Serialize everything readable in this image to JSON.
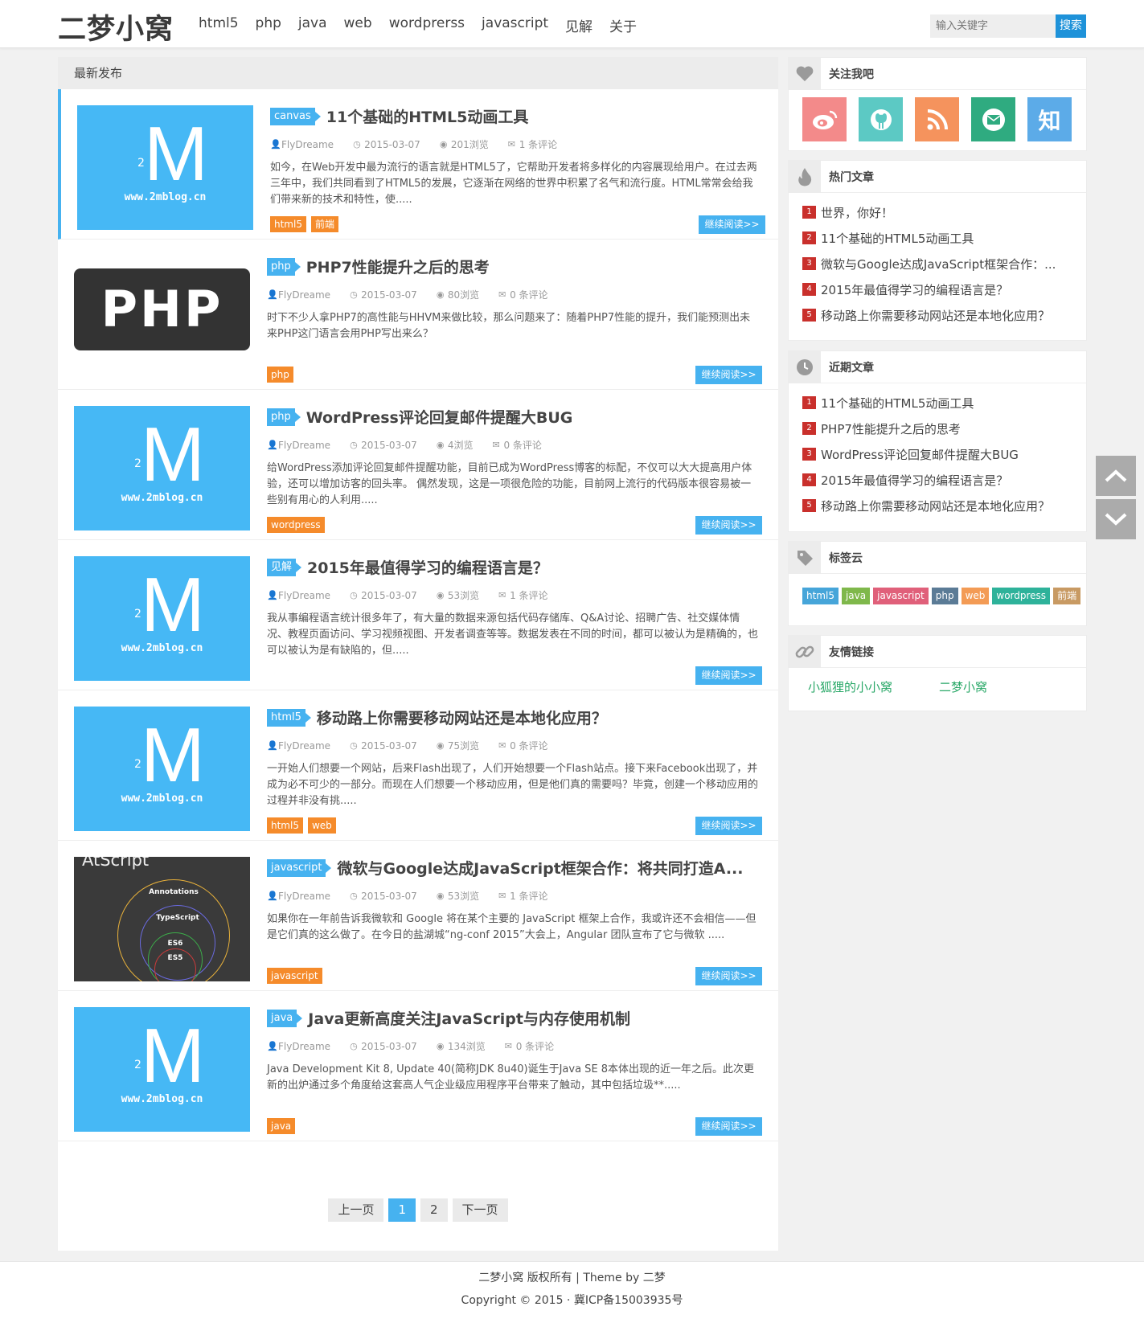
{
  "site": {
    "logo": "二梦小窝",
    "nav": [
      "html5",
      "php",
      "java",
      "web",
      "wordprerss",
      "javascript",
      "见解",
      "关于"
    ],
    "search_placeholder": "输入关键字",
    "search_btn": "搜索"
  },
  "main": {
    "heading": "最新发布",
    "more_label": "继续阅读>>"
  },
  "posts": [
    {
      "cat": "canvas",
      "title": "11个基础的HTML5动画工具",
      "author": "FlyDreame",
      "date": "2015-03-07",
      "views": "201浏览",
      "comments": "1 条评论",
      "excerpt": "如今，在Web开发中最为流行的语言就是HTML5了，它帮助开发者将多样化的内容展现给用户。在过去两三年中，我们共同看到了HTML5的发展，它逐渐在网络的世界中积累了名气和流行度。HTML常常会给我们带来新的技术和特性，使.....",
      "tags": [
        "html5",
        "前端"
      ],
      "thumb": "m"
    },
    {
      "cat": "php",
      "title": "PHP7性能提升之后的思考",
      "author": "FlyDreame",
      "date": "2015-03-07",
      "views": "80浏览",
      "comments": "0 条评论",
      "excerpt": "时下不少人拿PHP7的高性能与HHVM来做比较，那么问题来了：随着PHP7性能的提升，我们能预测出未来PHP这门语言会用PHP写出来么？",
      "tags": [
        "php"
      ],
      "thumb": "php"
    },
    {
      "cat": "php",
      "title": "WordPress评论回复邮件提醒大BUG",
      "author": "FlyDreame",
      "date": "2015-03-07",
      "views": "4浏览",
      "comments": "0 条评论",
      "excerpt": "给WordPress添加评论回复邮件提醒功能，目前已成为WordPress博客的标配，不仅可以大大提高用户体验，还可以增加访客的回头率。 偶然发现，这是一项很危险的功能，目前网上流行的代码版本很容易被一些别有用心的人利用.....",
      "tags": [
        "wordpress"
      ],
      "thumb": "m"
    },
    {
      "cat": "见解",
      "title": "2015年最值得学习的编程语言是？",
      "author": "FlyDreame",
      "date": "2015-03-07",
      "views": "53浏览",
      "comments": "1 条评论",
      "excerpt": " 我从事编程语言统计很多年了，有大量的数据来源包括代码存储库、Q&A讨论、招聘广告、社交媒体情况、教程页面访问、学习视频视图、开发者调查等等。数据发表在不同的时间，都可以被认为是精确的，也可以被认为是有缺陷的，但.....",
      "tags": [],
      "thumb": "m"
    },
    {
      "cat": "html5",
      "title": "移动路上你需要移动网站还是本地化应用？",
      "author": "FlyDreame",
      "date": "2015-03-07",
      "views": "75浏览",
      "comments": "0 条评论",
      "excerpt": " 一开始人们想要一个网站，后来Flash出现了，人们开始想要一个Flash站点。接下来Facebook出现了，并成为必不可少的一部分。而现在人们想要一个移动应用，但是他们真的需要吗？毕竟，创建一个移动应用的过程并非没有挑.....",
      "tags": [
        "html5",
        "web"
      ],
      "thumb": "m"
    },
    {
      "cat": "javascript",
      "title": "微软与Google达成JavaScript框架合作：将共同打造A...",
      "author": "FlyDreame",
      "date": "2015-03-07",
      "views": "53浏览",
      "comments": "1 条评论",
      "excerpt": "如果你在一年前告诉我微软和 Google 将在某个主要的 JavaScript 框架上合作，我或许还不会相信——但是它们真的这么做了。在今日的盐湖城“ng-conf 2015”大会上，Angular 团队宣布了它与微软 .....",
      "tags": [
        "javascript"
      ],
      "thumb": "ats"
    },
    {
      "cat": "java",
      "title": "Java更新高度关注JavaScript与内存使用机制",
      "author": "FlyDreame",
      "date": "2015-03-07",
      "views": "134浏览",
      "comments": "0 条评论",
      "excerpt": "Java Development Kit 8, Update 40(简称JDK 8u40)诞生于Java SE 8本体出现的近一年之后。此次更新的出炉通过多个角度给这套高人气企业级应用程序平台带来了触动，其中包括垃圾**.....",
      "tags": [
        "java"
      ],
      "thumb": "m"
    }
  ],
  "thumbs": {
    "m_letter": "M",
    "m_sub": "2",
    "m_site": "www.2mblog.cn",
    "php_text": "PHP",
    "ats_title": "AtScript",
    "ats_rings": [
      "Annotations",
      "TypeScript",
      "ES6",
      "ES5"
    ]
  },
  "pager": {
    "prev": "上一页",
    "pages": [
      "1",
      "2"
    ],
    "current": "1",
    "next": "下一页"
  },
  "sidebar": {
    "follow": {
      "title": "关注我吧",
      "icons": [
        "weibo-icon",
        "github-icon",
        "rss-icon",
        "mail-icon",
        "zhihu-icon"
      ],
      "zhihu_glyph": "知"
    },
    "hot": {
      "title": "热门文章",
      "items": [
        "世界，你好！",
        "11个基础的HTML5动画工具",
        "微软与Google达成JavaScript框架合作：...",
        "2015年最值得学习的编程语言是？",
        "移动路上你需要移动网站还是本地化应用？"
      ]
    },
    "recent": {
      "title": "近期文章",
      "items": [
        "11个基础的HTML5动画工具",
        "PHP7性能提升之后的思考",
        "WordPress评论回复邮件提醒大BUG",
        "2015年最值得学习的编程语言是？",
        "移动路上你需要移动网站还是本地化应用？"
      ]
    },
    "tags": {
      "title": "标签云",
      "items": [
        "html5",
        "java",
        "javascript",
        "php",
        "web",
        "wordpress",
        "前端"
      ]
    },
    "links": {
      "title": "友情链接",
      "items": [
        "小狐狸的小小窝",
        "二梦小窝"
      ]
    }
  },
  "colors": {
    "accent": "#46b2f0",
    "tag_orange": "#f58b2b",
    "num_red": "#c9302c",
    "tagcloud": [
      "#46a5d9",
      "#7fb84b",
      "#e0607a",
      "#5b7b96",
      "#f39b55",
      "#2eb29a",
      "#c89a63"
    ],
    "social": [
      "#f38a8a",
      "#5cc9c4",
      "#f5935d",
      "#2fab80",
      "#5cabe8"
    ]
  },
  "footer": {
    "line1": "二梦小窝 版权所有 | Theme by 二梦",
    "line2": "Copyright © 2015 · 冀ICP备15003935号"
  }
}
